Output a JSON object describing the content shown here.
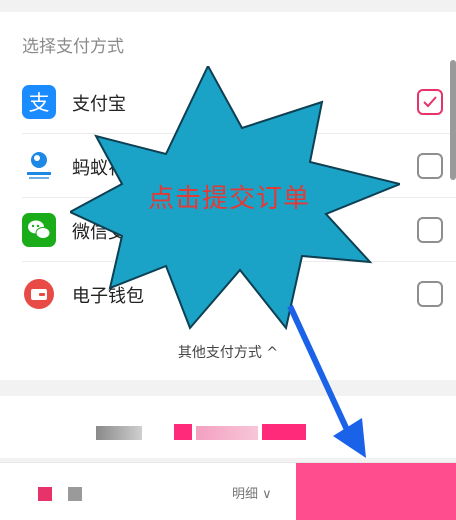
{
  "payment": {
    "section_title": "选择支付方式",
    "methods": [
      {
        "label": "支付宝",
        "icon": "alipay-icon",
        "checked": true
      },
      {
        "label": "蚂蚁花呗",
        "icon": "huabei-icon",
        "checked": false
      },
      {
        "label": "微信支付",
        "icon": "wechat-pay-icon",
        "checked": false
      },
      {
        "label": "电子钱包",
        "icon": "wallet-icon",
        "checked": false
      }
    ],
    "other_methods": "其他支付方式 ^"
  },
  "annotation": {
    "callout_text": "点击提交订单",
    "callout_color": "#1aa3c7",
    "arrow_color": "#1a62e8"
  },
  "bottom_bar": {
    "detail_label": "明细 ∨"
  },
  "colors": {
    "accent": "#e8336a",
    "submit": "#ff4d8d"
  }
}
